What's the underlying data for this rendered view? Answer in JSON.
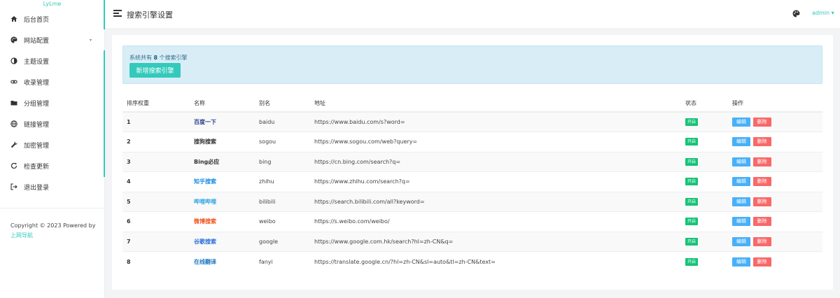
{
  "brand": "LyLme",
  "sidebar": {
    "items": [
      {
        "label": "后台首页",
        "icon": "home-icon"
      },
      {
        "label": "网站配置",
        "icon": "palette-icon"
      },
      {
        "label": "主题设置",
        "icon": "contrast-icon"
      },
      {
        "label": "收录管理",
        "icon": "link-icon"
      },
      {
        "label": "分组管理",
        "icon": "folder-icon"
      },
      {
        "label": "链接管理",
        "icon": "globe-icon"
      },
      {
        "label": "加密管理",
        "icon": "wrench-icon"
      },
      {
        "label": "检查更新",
        "icon": "refresh-icon"
      },
      {
        "label": "退出登录",
        "icon": "logout-icon"
      }
    ],
    "copyright_text": "Copyright © 2023 Powered by",
    "copyright_link": "上网导航"
  },
  "header": {
    "title": "搜索引擎设置",
    "user": "admin"
  },
  "alert": {
    "prefix": "系统共有 ",
    "count": "8",
    "suffix": " 个搜索引擎",
    "add_button": "新增搜索引擎"
  },
  "table": {
    "headers": [
      "排序权重",
      "名称",
      "别名",
      "地址",
      "状态",
      "操作"
    ],
    "rows": [
      {
        "rank": "1",
        "name": "百度一下",
        "name_color": "#2c3e8f",
        "alias": "baidu",
        "url": "https://www.baidu.com/s?word=",
        "status": "开启"
      },
      {
        "rank": "2",
        "name": "搜狗搜索",
        "name_color": "#333333",
        "alias": "sogou",
        "url": "https://www.sogou.com/web?query=",
        "status": "开启"
      },
      {
        "rank": "3",
        "name": "Bing必应",
        "name_color": "#333333",
        "alias": "bing",
        "url": "https://cn.bing.com/search?q=",
        "status": "开启"
      },
      {
        "rank": "4",
        "name": "知乎搜索",
        "name_color": "#1a8fe0",
        "alias": "zhihu",
        "url": "https://www.zhihu.com/search?q=",
        "status": "开启"
      },
      {
        "rank": "5",
        "name": "哔哩哔哩",
        "name_color": "#2ea7e0",
        "alias": "bilibili",
        "url": "https://search.bilibili.com/all?keyword=",
        "status": "开启"
      },
      {
        "rank": "6",
        "name": "微博搜索",
        "name_color": "#f2531d",
        "alias": "weibo",
        "url": "https://s.weibo.com/weibo/",
        "status": "开启"
      },
      {
        "rank": "7",
        "name": "谷歌搜索",
        "name_color": "#2e6fd8",
        "alias": "google",
        "url": "https://www.google.com.hk/search?hl=zh-CN&q=",
        "status": "开启"
      },
      {
        "rank": "8",
        "name": "在线翻译",
        "name_color": "#1a78c2",
        "alias": "fanyi",
        "url": "https://translate.google.cn/?hl=zh-CN&sl=auto&tl=zh-CN&text=",
        "status": "开启"
      }
    ],
    "edit_label": "编辑",
    "delete_label": "删除"
  },
  "colors": {
    "accent": "#33cabb",
    "status_green": "#15c377",
    "edit_blue": "#48b0f7",
    "delete_red": "#f96868"
  }
}
